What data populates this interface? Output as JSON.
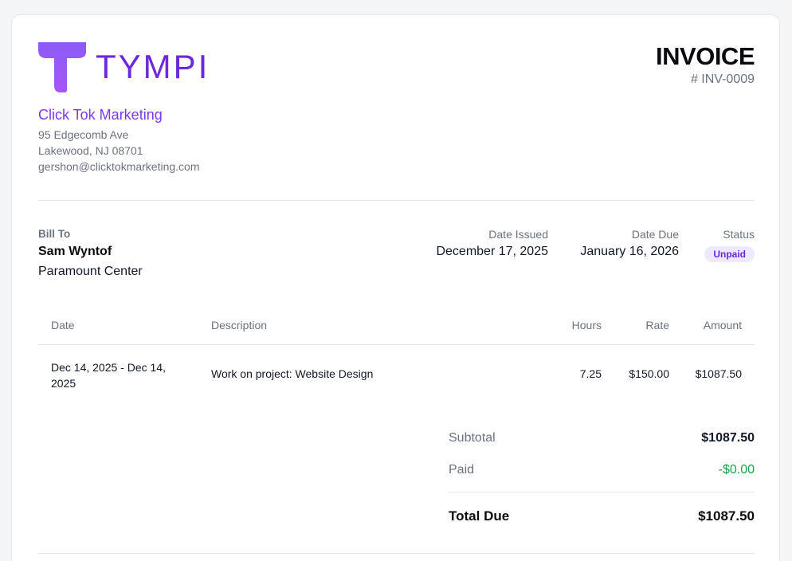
{
  "brand": {
    "logo_text": "TYMPI",
    "colors": {
      "accent": "#7c3aed",
      "accent_light": "#a855f7",
      "paid_green": "#16a34a",
      "badge_bg": "#ede9fe"
    }
  },
  "invoice": {
    "title": "INVOICE",
    "number": "# INV-0009"
  },
  "company": {
    "name": "Click Tok Marketing",
    "address_line1": "95 Edgecomb Ave",
    "address_line2": "Lakewood, NJ 08701",
    "email": "gershon@clicktokmarketing.com"
  },
  "bill_to": {
    "label": "Bill To",
    "name": "Sam Wyntof",
    "organization": "Paramount Center"
  },
  "meta": {
    "date_issued_label": "Date Issued",
    "date_issued": "December 17, 2025",
    "date_due_label": "Date Due",
    "date_due": "January 16, 2026",
    "status_label": "Status",
    "status": "Unpaid"
  },
  "table": {
    "headers": {
      "date": "Date",
      "description": "Description",
      "hours": "Hours",
      "rate": "Rate",
      "amount": "Amount"
    },
    "rows": [
      {
        "date": "Dec 14, 2025 - Dec 14, 2025",
        "description": "Work on project: Website Design",
        "hours": "7.25",
        "rate": "$150.00",
        "amount": "$1087.50"
      }
    ]
  },
  "totals": {
    "subtotal_label": "Subtotal",
    "subtotal": "$1087.50",
    "paid_label": "Paid",
    "paid": "-$0.00",
    "total_due_label": "Total Due",
    "total_due": "$1087.50"
  }
}
